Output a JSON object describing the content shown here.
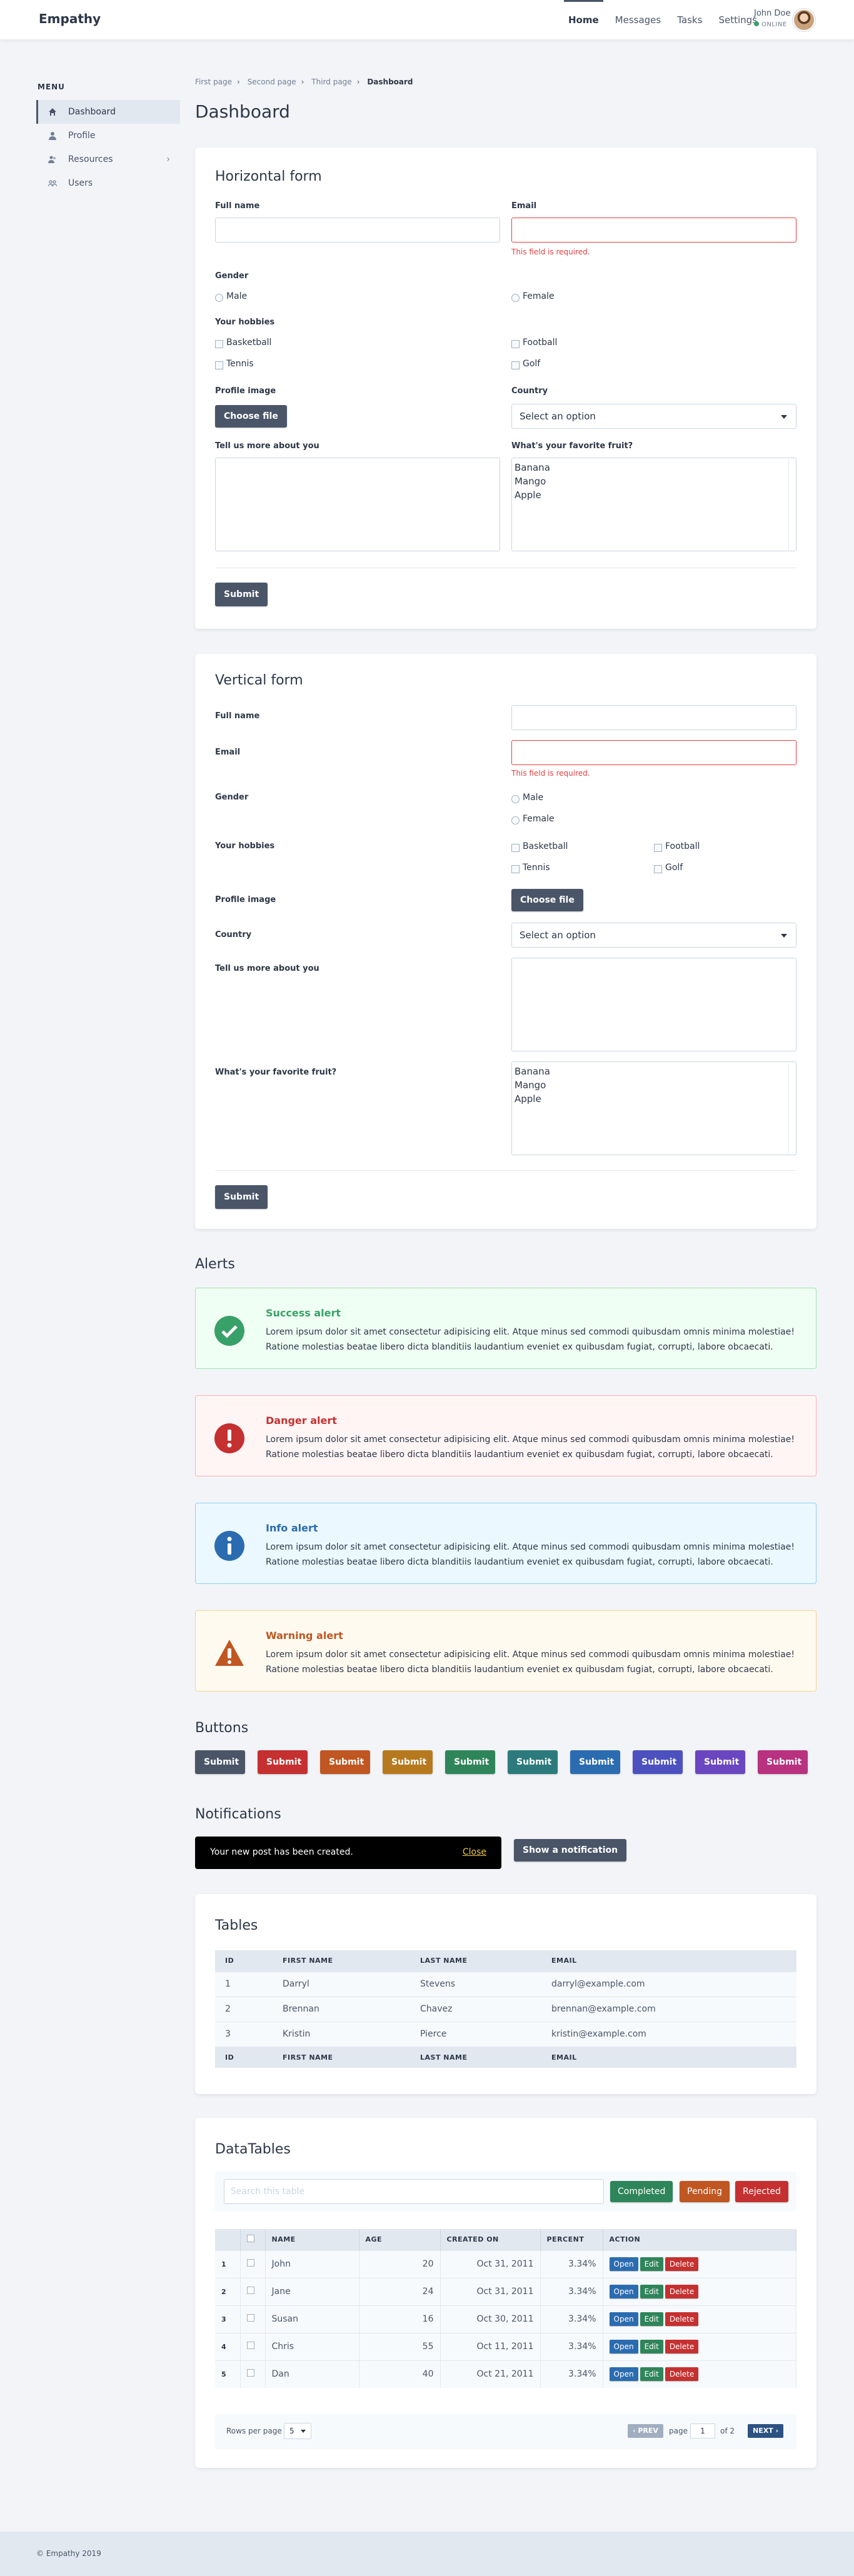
{
  "header": {
    "logo": "Empathy",
    "nav": [
      "Home",
      "Messages",
      "Tasks",
      "Settings"
    ],
    "user_name": "John Doe",
    "user_status": "ONLINE"
  },
  "sidebar": {
    "title": "MENU",
    "items": [
      {
        "label": "Dashboard",
        "icon": "home-icon"
      },
      {
        "label": "Profile",
        "icon": "user-icon"
      },
      {
        "label": "Resources",
        "icon": "users-icon"
      },
      {
        "label": "Users",
        "icon": "group-icon"
      }
    ]
  },
  "breadcrumb": [
    "First page",
    "Second page",
    "Third page",
    "Dashboard"
  ],
  "page_title": "Dashboard",
  "hform": {
    "title": "Horizontal form",
    "full_name": "Full name",
    "email": "Email",
    "error": "This field is required.",
    "gender": "Gender",
    "male": "Male",
    "female": "Female",
    "hobbies": "Your hobbies",
    "basketball": "Basketball",
    "football": "Football",
    "tennis": "Tennis",
    "golf": "Golf",
    "profile_image": "Profile image",
    "choose_file": "Choose file",
    "country": "Country",
    "select_option": "Select an option",
    "about": "Tell us more about you",
    "fruit": "What's your favorite fruit?",
    "fruits": [
      "Banana",
      "Mango",
      "Apple"
    ],
    "submit": "Submit"
  },
  "vform": {
    "title": "Vertical form",
    "full_name": "Full name",
    "email": "Email",
    "error": "This field is required.",
    "gender": "Gender",
    "male": "Male",
    "female": "Female",
    "hobbies": "Your hobbies",
    "basketball": "Basketball",
    "football": "Football",
    "tennis": "Tennis",
    "golf": "Golf",
    "profile_image": "Profile image",
    "choose_file": "Choose file",
    "country": "Country",
    "select_option": "Select an option",
    "about": "Tell us more about you",
    "fruit": "What's your favorite fruit?",
    "fruits": [
      "Banana",
      "Mango",
      "Apple"
    ],
    "submit": "Submit"
  },
  "alerts": {
    "title": "Alerts",
    "body": "Lorem ipsum dolor sit amet consectetur adipisicing elit. Atque minus sed commodi quibusdam omnis minima molestiae! Ratione molestias beatae libero dicta blanditiis laudantium eveniet ex quibusdam fugiat, corrupti, labore obcaecati.",
    "items": [
      {
        "title": "Success alert",
        "color": "#38a169",
        "bg": "#f0fff4",
        "border": "#9ae6b4",
        "icon": "check-circle-icon"
      },
      {
        "title": "Danger alert",
        "color": "#c53030",
        "bg": "#fff5f5",
        "border": "#feb2b2",
        "icon": "exclamation-circle-icon"
      },
      {
        "title": "Info alert",
        "color": "#2b6cb0",
        "bg": "#ebf8ff",
        "border": "#90cdf4",
        "icon": "info-circle-icon"
      },
      {
        "title": "Warning alert",
        "color": "#c05621",
        "bg": "#fffaf0",
        "border": "#fbd38d",
        "icon": "warning-triangle-icon"
      }
    ]
  },
  "buttons": {
    "title": "Buttons",
    "label": "Submit",
    "colors": [
      "#4a5568",
      "#c53030",
      "#c05621",
      "#b7791f",
      "#2f855a",
      "#2c7a7b",
      "#2b6cb0",
      "#4c51bf",
      "#6b46c1",
      "#b83280"
    ]
  },
  "notifications": {
    "title": "Notifications",
    "message": "Your new post has been created.",
    "close": "Close",
    "show": "Show a notification"
  },
  "tables": {
    "title": "Tables",
    "headers": [
      "ID",
      "FIRST NAME",
      "LAST NAME",
      "EMAIL"
    ],
    "rows": [
      [
        "1",
        "Darryl",
        "Stevens",
        "darryl@example.com"
      ],
      [
        "2",
        "Brennan",
        "Chavez",
        "brennan@example.com"
      ],
      [
        "3",
        "Kristin",
        "Pierce",
        "kristin@example.com"
      ]
    ]
  },
  "datatables": {
    "title": "DataTables",
    "search_placeholder": "Search this table",
    "filters": [
      {
        "label": "Completed",
        "color": "#2f855a"
      },
      {
        "label": "Pending",
        "color": "#c05621"
      },
      {
        "label": "Rejected",
        "color": "#c53030"
      }
    ],
    "headers": [
      "",
      "",
      "NAME",
      "AGE",
      "CREATED ON",
      "PERCENT",
      "ACTION"
    ],
    "rows": [
      {
        "n": "1",
        "name": "John",
        "age": "20",
        "created": "Oct 31, 2011",
        "percent": "3.34%"
      },
      {
        "n": "2",
        "name": "Jane",
        "age": "24",
        "created": "Oct 31, 2011",
        "percent": "3.34%"
      },
      {
        "n": "3",
        "name": "Susan",
        "age": "16",
        "created": "Oct 30, 2011",
        "percent": "3.34%"
      },
      {
        "n": "4",
        "name": "Chris",
        "age": "55",
        "created": "Oct 11, 2011",
        "percent": "3.34%"
      },
      {
        "n": "5",
        "name": "Dan",
        "age": "40",
        "created": "Oct 21, 2011",
        "percent": "3.34%"
      }
    ],
    "actions": [
      "Open",
      "Edit",
      "Delete"
    ],
    "rows_per_page": "Rows per page",
    "per_page_value": "5",
    "prev": "PREV",
    "page": "page",
    "page_value": "1",
    "of": "of 2",
    "next": "NEXT"
  },
  "footer": "© Empathy 2019"
}
